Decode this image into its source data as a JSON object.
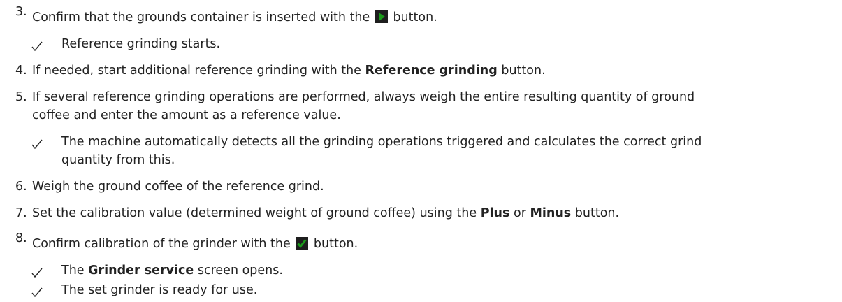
{
  "steps": [
    {
      "number": "3.",
      "text_before": "Confirm that the grounds container is inserted with the",
      "icon": "play-icon",
      "text_after": "button.",
      "results": [
        "Reference grinding starts."
      ]
    },
    {
      "number": "4.",
      "text_before": "If needed, start additional reference grinding with the",
      "bold": "Reference grinding",
      "text_after": "button."
    },
    {
      "number": "5.",
      "line1": "If several reference grinding operations are performed, always weigh the entire resulting quantity of ground",
      "line2": "coffee and enter the amount as a reference value.",
      "results": [
        {
          "line1": "The machine automatically detects all the grinding operations triggered and calculates the correct grind",
          "line2": "quantity from this."
        }
      ]
    },
    {
      "number": "6.",
      "text": "Weigh the ground coffee of the reference grind."
    },
    {
      "number": "7.",
      "text_before": "Set the calibration value (determined weight of ground coffee) using the",
      "bold1": "Plus",
      "mid": "or",
      "bold2": "Minus",
      "text_after": "button."
    },
    {
      "number": "8.",
      "text_before": "Confirm calibration of the grinder with the",
      "icon": "checkmark-icon",
      "text_after": "button.",
      "results": [
        {
          "pre": "The",
          "bold": "Grinder service",
          "post": "screen opens."
        },
        "The set grinder is ready for use."
      ]
    }
  ],
  "colors": {
    "text": "#222222",
    "icon_green": "#1a9a1a",
    "icon_dark": "#1e1e1e"
  }
}
